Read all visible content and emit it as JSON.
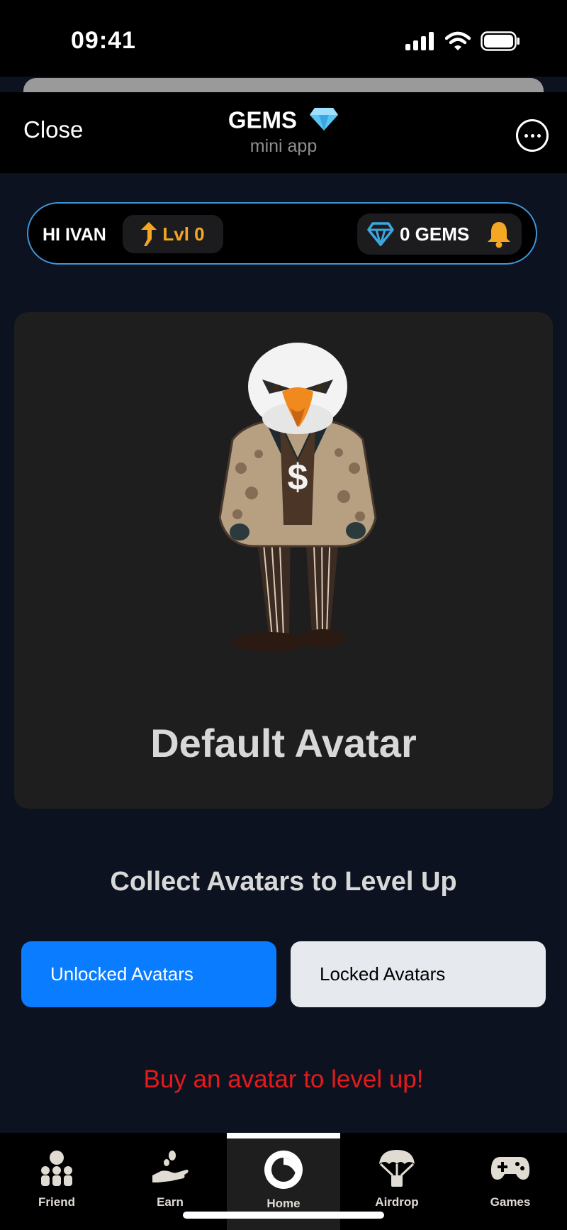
{
  "status": {
    "time": "09:41"
  },
  "header": {
    "close_label": "Close",
    "title": "GEMS",
    "subtitle": "mini app"
  },
  "user_bar": {
    "greeting": "HI IVAN",
    "level": "Lvl 0",
    "gems": "0 GEMS"
  },
  "avatar": {
    "name": "Default Avatar"
  },
  "collect_heading": "Collect Avatars to Level Up",
  "tabs": {
    "unlocked": "Unlocked Avatars",
    "locked": "Locked Avatars"
  },
  "buy_message": "Buy an avatar to level up!",
  "nav": {
    "items": [
      {
        "label": "Friend",
        "icon": "friends-icon"
      },
      {
        "label": "Earn",
        "icon": "earn-icon"
      },
      {
        "label": "Home",
        "icon": "home-icon",
        "active": true
      },
      {
        "label": "Airdrop",
        "icon": "airdrop-icon"
      },
      {
        "label": "Games",
        "icon": "gamepad-icon"
      }
    ]
  },
  "colors": {
    "accent": "#0a7cff",
    "gold": "#f5a623",
    "border": "#3d95d8",
    "error": "#e61a1a"
  }
}
